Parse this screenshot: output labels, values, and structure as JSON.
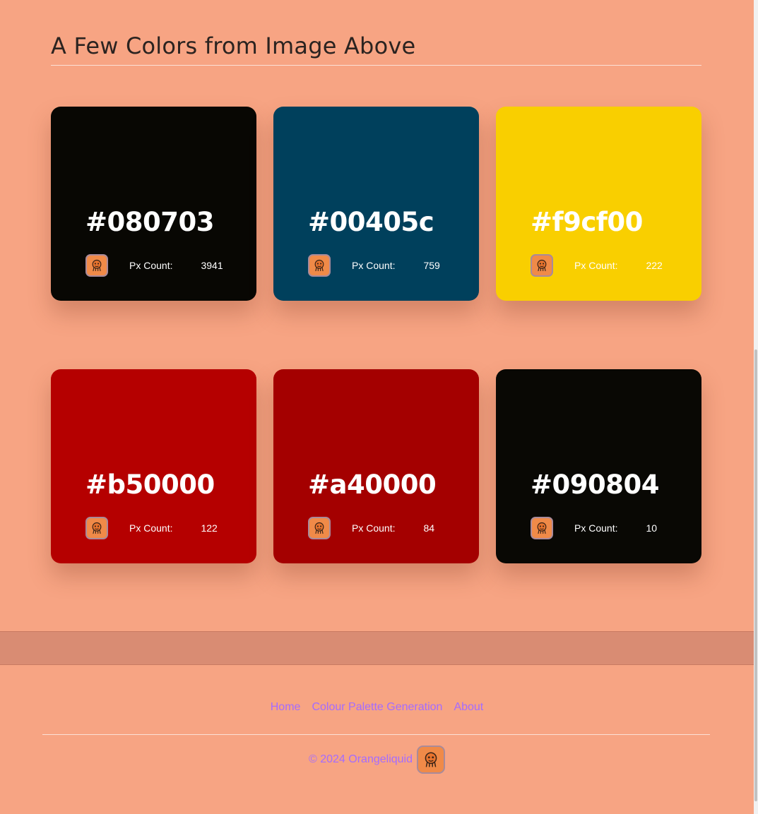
{
  "section": {
    "title": "A Few Colors from Image Above"
  },
  "cards": [
    {
      "hex": "#080703",
      "label": "Px Count:",
      "count": "3941",
      "bg": "#080703",
      "avatar_icon": "orange-mascot-icon"
    },
    {
      "hex": "#00405c",
      "label": "Px Count:",
      "count": "759",
      "bg": "#00405c",
      "avatar_icon": "orange-mascot-icon"
    },
    {
      "hex": "#f9cf00",
      "label": "Px Count:",
      "count": "222",
      "bg": "#f9cf00",
      "avatar_icon": "orange-mascot-icon"
    },
    {
      "hex": "#b50000",
      "label": "Px Count:",
      "count": "122",
      "bg": "#b50000",
      "avatar_icon": "orange-mascot-icon"
    },
    {
      "hex": "#a40000",
      "label": "Px Count:",
      "count": "84",
      "bg": "#a40000",
      "avatar_icon": "orange-mascot-icon"
    },
    {
      "hex": "#090804",
      "label": "Px Count:",
      "count": "10",
      "bg": "#090804",
      "avatar_icon": "orange-mascot-icon"
    }
  ],
  "footer": {
    "nav": [
      {
        "label": "Home"
      },
      {
        "label": "Colour Palette Generation"
      },
      {
        "label": "About"
      }
    ],
    "copyright": "© 2024 Orangeliquid"
  },
  "colors": {
    "page_bg": "#f7a483",
    "link": "#a46cff",
    "band": "#d98c73",
    "title": "#2b2320"
  }
}
